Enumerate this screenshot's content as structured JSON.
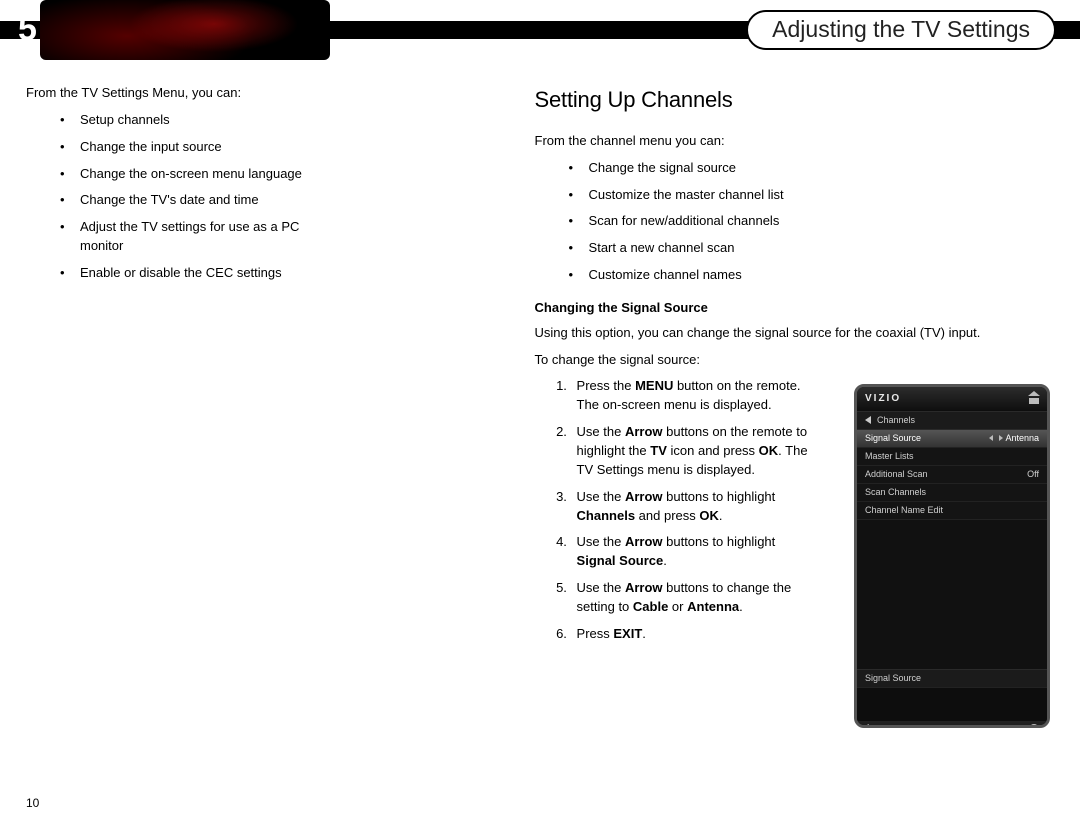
{
  "header": {
    "chapter_number": "5",
    "chapter_title": "Adjusting the TV Settings"
  },
  "left": {
    "intro": "From the TV Settings Menu, you can:",
    "bullets": [
      "Setup channels",
      "Change the input source",
      "Change the on-screen menu language",
      "Change the TV's date and time",
      "Adjust the TV settings for use as a PC monitor",
      "Enable or disable the CEC settings"
    ]
  },
  "right": {
    "section_title": "Setting Up Channels",
    "intro": "From the channel menu you can:",
    "bullets": [
      "Change the signal source",
      "Customize the master channel list",
      "Scan for new/additional channels",
      "Start a new channel scan",
      "Customize channel names"
    ],
    "subhead": "Changing the Signal Source",
    "desc": "Using this option, you can change the signal source for the coaxial (TV) input.",
    "lead": "To change the signal source:",
    "steps": [
      {
        "pre": "Press the ",
        "b1": "MENU",
        "mid": " button on the remote. The on-screen menu is displayed."
      },
      {
        "pre": "Use the ",
        "b1": "Arrow",
        "mid": " buttons on the remote to highlight the ",
        "b2": "TV",
        "mid2": " icon and press ",
        "b3": "OK",
        "end": ". The TV Settings menu is displayed."
      },
      {
        "pre": "Use the ",
        "b1": "Arrow",
        "mid": " buttons to highlight ",
        "b2": "Channels",
        "mid2": " and press ",
        "b3": "OK",
        "end": "."
      },
      {
        "pre": "Use the ",
        "b1": "Arrow",
        "mid": " buttons to highlight ",
        "b2": "Signal Source",
        "end": "."
      },
      {
        "pre": "Use the ",
        "b1": "Arrow",
        "mid": " buttons to change the setting to ",
        "b2": "Cable",
        "mid2": " or ",
        "b3": "Antenna",
        "end": "."
      },
      {
        "pre": "Press ",
        "b1": "EXIT",
        "end": "."
      }
    ]
  },
  "tv_menu": {
    "logo": "VIZIO",
    "breadcrumb": "Channels",
    "rows": {
      "signal_source": {
        "label": "Signal Source",
        "value": "Antenna"
      },
      "master_lists": "Master Lists",
      "additional_scan": {
        "label": "Additional Scan",
        "value": "Off"
      },
      "scan_channels": "Scan Channels",
      "channel_name_edit": "Channel Name Edit"
    },
    "status": "Signal Source",
    "footer_left": "LAST",
    "footer_right": "EXIT"
  },
  "page_number": "10"
}
